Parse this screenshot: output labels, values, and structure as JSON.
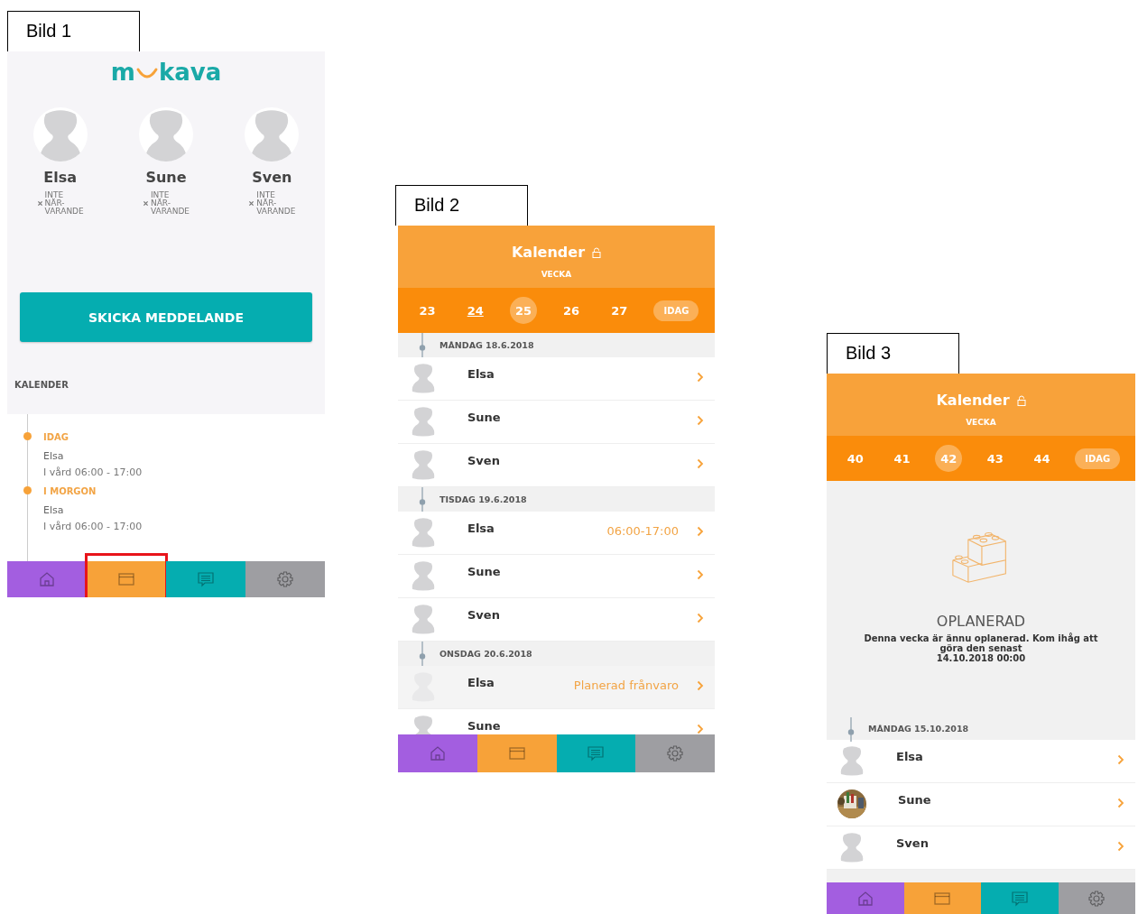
{
  "panels": [
    {
      "label": "Bild 1",
      "screen": {
        "kind": "home",
        "logo": {
          "start": "m",
          "end": "kava"
        },
        "children": [
          {
            "name": "Elsa",
            "status_lines": [
              "INTE",
              "NÄR-",
              "VARANDE"
            ]
          },
          {
            "name": "Sune",
            "status_lines": [
              "INTE",
              "NÄR-",
              "VARANDE"
            ]
          },
          {
            "name": "Sven",
            "status_lines": [
              "INTE",
              "NÄR-",
              "VARANDE"
            ]
          }
        ],
        "button": "SKICKA MEDDELANDE",
        "section_title": "KALENDER",
        "timeline": [
          {
            "day": "IDAG",
            "name": "Elsa",
            "detail": "I vård  06:00 - 17:00"
          },
          {
            "day": "I MORGON",
            "name": "Elsa",
            "detail": "I vård  06:00 - 17:00"
          }
        ],
        "nav": [
          {
            "kind": "home",
            "color": "#a35ee0",
            "highlighted": false
          },
          {
            "kind": "calendar",
            "color": "#f7a239",
            "highlighted": true
          },
          {
            "kind": "messages",
            "color": "#05adb0",
            "highlighted": false
          },
          {
            "kind": "settings",
            "color": "#9e9ea2",
            "highlighted": false
          }
        ]
      }
    },
    {
      "label": "Bild 2",
      "screen": {
        "kind": "calendar",
        "title": "Kalender",
        "subtitle": "VECKA",
        "weeks": [
          {
            "label": "23",
            "selected": false,
            "current": false
          },
          {
            "label": "24",
            "selected": false,
            "current": true
          },
          {
            "label": "25",
            "selected": true,
            "current": false
          },
          {
            "label": "26",
            "selected": false,
            "current": false
          },
          {
            "label": "27",
            "selected": false,
            "current": false
          }
        ],
        "today_button": "IDAG",
        "days": [
          {
            "date": "MÅNDAG 18.6.2018",
            "rows": [
              {
                "name": "Elsa",
                "kind": "placeholder",
                "faded": false
              },
              {
                "name": "Sune",
                "kind": "placeholder",
                "faded": false
              },
              {
                "name": "Sven",
                "kind": "placeholder",
                "faded": false
              }
            ]
          },
          {
            "date": "TISDAG 19.6.2018",
            "rows": [
              {
                "name": "Elsa",
                "kind": "placeholder",
                "info": "06:00-17:00",
                "faded": false
              },
              {
                "name": "Sune",
                "kind": "placeholder",
                "faded": false
              },
              {
                "name": "Sven",
                "kind": "placeholder",
                "faded": false
              }
            ]
          },
          {
            "date": "ONSDAG 20.6.2018",
            "rows": [
              {
                "name": "Elsa",
                "kind": "placeholder",
                "info": "Planerad frånvaro",
                "faded": true
              },
              {
                "name": "Sune",
                "kind": "placeholder",
                "faded": false
              }
            ]
          }
        ],
        "nav": [
          {
            "kind": "home",
            "color": "#a35ee0",
            "highlighted": false
          },
          {
            "kind": "calendar",
            "color": "#f7a239",
            "highlighted": false
          },
          {
            "kind": "messages",
            "color": "#05adb0",
            "highlighted": false
          },
          {
            "kind": "settings",
            "color": "#9e9ea2",
            "highlighted": false
          }
        ]
      }
    },
    {
      "label": "Bild 3",
      "screen": {
        "kind": "calendar",
        "title": "Kalender",
        "subtitle": "VECKA",
        "weeks": [
          {
            "label": "40",
            "selected": false,
            "current": false
          },
          {
            "label": "41",
            "selected": false,
            "current": false
          },
          {
            "label": "42",
            "selected": true,
            "current": false
          },
          {
            "label": "43",
            "selected": false,
            "current": false
          },
          {
            "label": "44",
            "selected": false,
            "current": false
          }
        ],
        "today_button": "IDAG",
        "notice": {
          "title": "OPLANERAD",
          "message": "Denna vecka är ännu oplanerad. Kom ihåg att göra den senast",
          "deadline": "14.10.2018 00:00"
        },
        "days": [
          {
            "date": "MÅNDAG 15.10.2018",
            "rows": [
              {
                "name": "Elsa",
                "kind": "placeholder",
                "faded": false
              },
              {
                "name": "Sune",
                "faded": false
              },
              {
                "name": "Sven",
                "kind": "placeholder",
                "faded": false
              }
            ]
          }
        ],
        "nav": [
          {
            "kind": "home",
            "color": "#a35ee0",
            "highlighted": false
          },
          {
            "kind": "calendar",
            "color": "#f7a239",
            "highlighted": false
          },
          {
            "kind": "messages",
            "color": "#05adb0",
            "highlighted": false
          },
          {
            "kind": "settings",
            "color": "#9e9ea2",
            "highlighted": false
          }
        ]
      }
    }
  ]
}
